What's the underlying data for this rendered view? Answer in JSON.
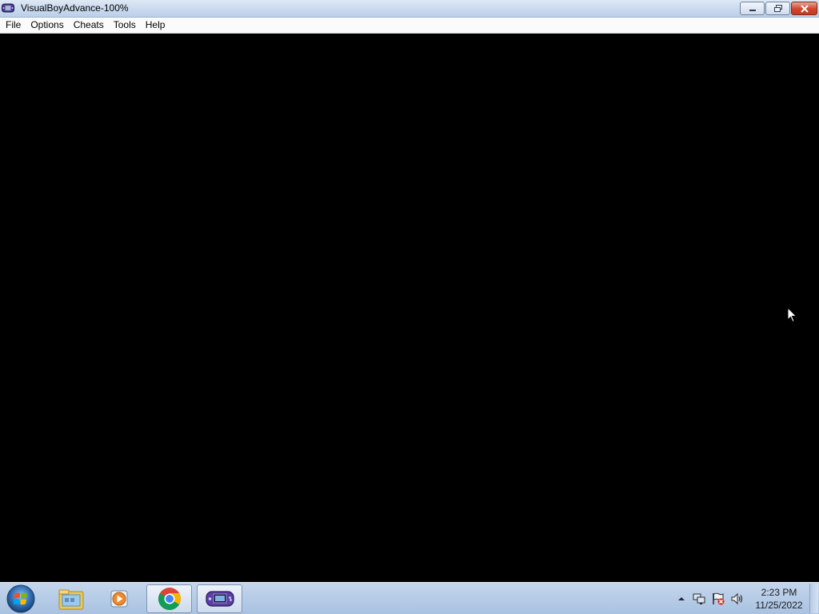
{
  "window": {
    "title": "VisualBoyAdvance-100%",
    "icon": "gba-icon",
    "controls": {
      "minimize": "minimize-icon",
      "restore": "restore-icon",
      "close": "close-icon"
    }
  },
  "menubar": {
    "items": [
      "File",
      "Options",
      "Cheats",
      "Tools",
      "Help"
    ]
  },
  "taskbar": {
    "start": "windows-start-icon",
    "apps": [
      {
        "name": "file-explorer-icon"
      },
      {
        "name": "media-player-icon"
      },
      {
        "name": "chrome-icon"
      },
      {
        "name": "visualboyadvance-icon"
      }
    ],
    "tray": {
      "icons": [
        "show-hidden-icons-arrow",
        "network-icon",
        "action-center-flag-icon",
        "volume-icon"
      ],
      "time": "2:23 PM",
      "date": "11/25/2022"
    }
  },
  "colors": {
    "game_background": "#000000",
    "taskbar": "#b3c9e6",
    "close_button": "#c9422a"
  }
}
